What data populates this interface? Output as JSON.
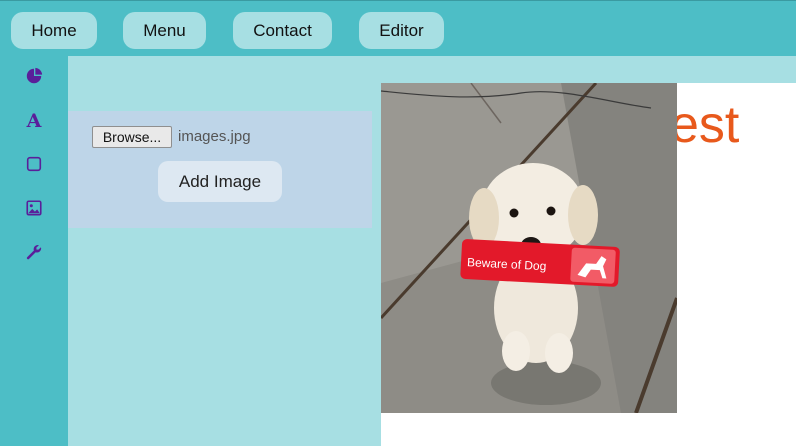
{
  "nav": {
    "items": [
      "Home",
      "Menu",
      "Contact",
      "Editor"
    ]
  },
  "sidebar": {
    "icons": [
      "pie-chart-icon",
      "text-icon",
      "square-icon",
      "image-icon",
      "wrench-icon"
    ],
    "text_icon_glyph": "A",
    "icon_color": "#5a1f9a"
  },
  "panel": {
    "browse_label": "Browse...",
    "file_name": "images.jpg",
    "add_image_label": "Add Image"
  },
  "page": {
    "title_fragment": "est",
    "title_color": "#e8591c"
  },
  "photo": {
    "sign_text": "Beware of Dog"
  },
  "colors": {
    "topbar": "#4dbec6",
    "background": "#a7dfe3",
    "panel": "#bed5e8"
  }
}
